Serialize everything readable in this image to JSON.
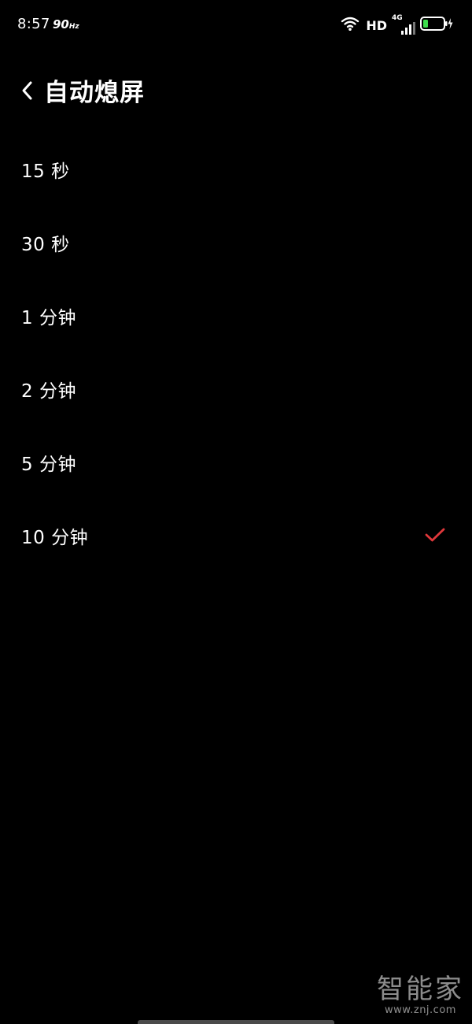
{
  "status_bar": {
    "time": "8:57",
    "refresh_rate": "90",
    "refresh_unit": "Hz",
    "hd_label": "HD",
    "network_type": "4G",
    "battery_level": 0.25
  },
  "header": {
    "title": "自动熄屏"
  },
  "options": [
    {
      "label": "15 秒",
      "selected": false
    },
    {
      "label": "30 秒",
      "selected": false
    },
    {
      "label": "1 分钟",
      "selected": false
    },
    {
      "label": "2 分钟",
      "selected": false
    },
    {
      "label": "5 分钟",
      "selected": false
    },
    {
      "label": "10 分钟",
      "selected": true
    }
  ],
  "colors": {
    "background": "#000000",
    "text": "#ffffff",
    "check_accent": "#e0383b",
    "battery_fill": "#3ddc4c"
  },
  "watermark": {
    "logo": "智能家",
    "url": "www.znj.com"
  }
}
